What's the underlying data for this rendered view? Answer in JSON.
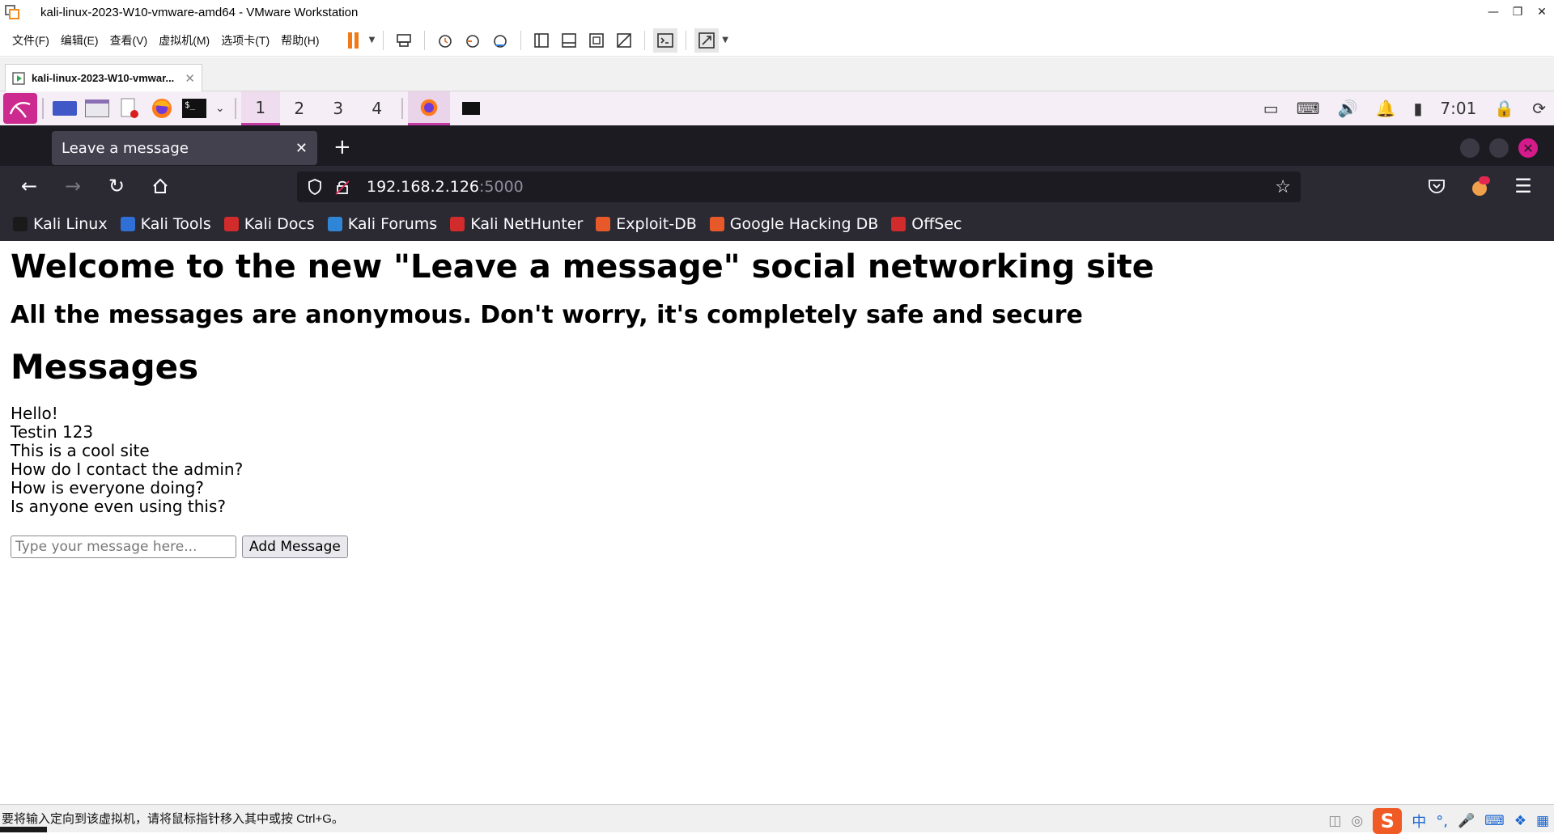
{
  "vmware": {
    "title": "kali-linux-2023-W10-vmware-amd64 - VMware Workstation",
    "menu": [
      "文件(F)",
      "编辑(E)",
      "查看(V)",
      "虚拟机(M)",
      "选项卡(T)",
      "帮助(H)"
    ],
    "tab_label": "kali-linux-2023-W10-vmwar...",
    "status_text": "要将输入定向到该虚拟机，请将鼠标指针移入其中或按 Ctrl+G。",
    "ime": {
      "logo": "S",
      "lang": "中",
      "punct": "°,"
    }
  },
  "kali_panel": {
    "workspaces": [
      "1",
      "2",
      "3",
      "4"
    ],
    "active_workspace": "1",
    "clock": "7:01"
  },
  "firefox": {
    "tab_title": "Leave a message",
    "url_host": "192.168.2.126",
    "url_port": ":5000",
    "bookmarks": [
      {
        "label": "Kali Linux",
        "color": "#1a1a1a"
      },
      {
        "label": "Kali Tools",
        "color": "#2f6fd6"
      },
      {
        "label": "Kali Docs",
        "color": "#d22b2b"
      },
      {
        "label": "Kali Forums",
        "color": "#2f86d6"
      },
      {
        "label": "Kali NetHunter",
        "color": "#d22b2b"
      },
      {
        "label": "Exploit-DB",
        "color": "#e8592a"
      },
      {
        "label": "Google Hacking DB",
        "color": "#e8592a"
      },
      {
        "label": "OffSec",
        "color": "#d22b2b"
      }
    ]
  },
  "page": {
    "heading": "Welcome to the new \"Leave a message\" social networking site",
    "subheading": "All the messages are anonymous. Don't worry, it's completely safe and secure",
    "messages_heading": "Messages",
    "messages": [
      "Hello!",
      "Testin 123",
      "This is a cool site",
      "How do I contact the admin?",
      "How is everyone doing?",
      "Is anyone even using this?"
    ],
    "input_placeholder": "Type your message here...",
    "input_value": "",
    "button_label": "Add Message"
  },
  "colors": {
    "kali_accent": "#c23aa2",
    "vmware_pause": "#f07a1a",
    "firefox_bg": "#1c1b22"
  }
}
